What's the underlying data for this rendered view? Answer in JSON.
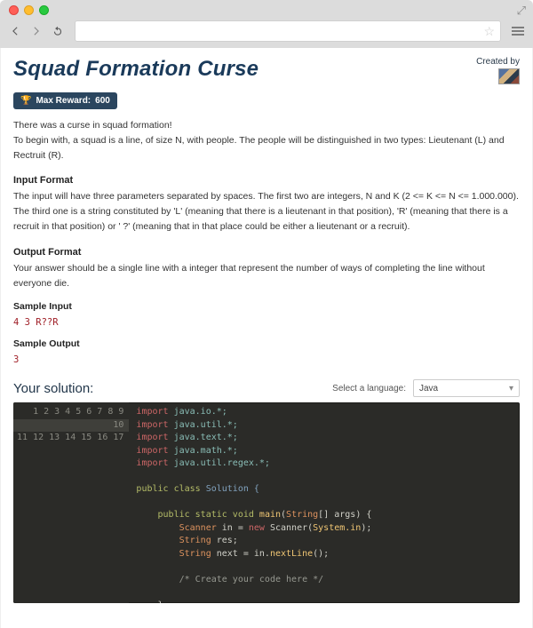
{
  "browser": {
    "expand_glyph": "⤢"
  },
  "header": {
    "title": "Squad Formation Curse",
    "created_by_label": "Created by"
  },
  "reward": {
    "label": "Max Reward:",
    "value": "600"
  },
  "description": {
    "p1": "There was a curse in squad formation!",
    "p2": "To begin with, a squad is a line, of size N, with people. The people will be distinguished in two types: Lieutenant (L) and Rectruit (R)."
  },
  "input_format": {
    "title": "Input Format",
    "body": "The input will have three parameters separated by spaces. The first two are integers, N and K (2 <= K <= N <= 1.000.000). The third one is a string constituted by 'L' (meaning that there is a lieutenant in that position), 'R' (meaning that there is a recruit in that position) or ' ?' (meaning that in that place could be either a lieutenant or a recruit)."
  },
  "output_format": {
    "title": "Output Format",
    "body": "Your answer should be a single line with a integer that represent the number of ways of completing the line without everyone die."
  },
  "sample_input": {
    "title": "Sample Input",
    "code": "4 3 R??R"
  },
  "sample_output": {
    "title": "Sample Output",
    "code": "3"
  },
  "solution": {
    "heading": "Your solution:",
    "select_label": "Select a language:",
    "language": "Java",
    "gutter": "1\n2\n3\n4\n5\n6\n7\n8\n9\n10\n11\n12\n13\n14\n15\n16\n17",
    "code": {
      "l1a": "import",
      "l1b": "java.io.*;",
      "l2a": "import",
      "l2b": "java.util.*;",
      "l3a": "import",
      "l3b": "java.text.*;",
      "l4a": "import",
      "l4b": "java.math.*;",
      "l5a": "import",
      "l5b": "java.util.regex.*;",
      "l7a": "public class",
      "l7b": "Solution {",
      "l9a": "public static void",
      "l9b": "main",
      "l9c": "(",
      "l9d": "String",
      "l9e": "[] args) {",
      "l10a": "Scanner",
      "l10b": "in",
      "l10c": " = ",
      "l10d": "new",
      "l10e": " Scanner(",
      "l10f": "System.in",
      "l10g": ");",
      "l11a": "String",
      "l11b": " res;",
      "l12a": "String",
      "l12b": " next = in.",
      "l12c": "nextLine",
      "l12d": "();",
      "l14": "/* Create your code here */",
      "l16": "    }",
      "l17": "}"
    }
  }
}
